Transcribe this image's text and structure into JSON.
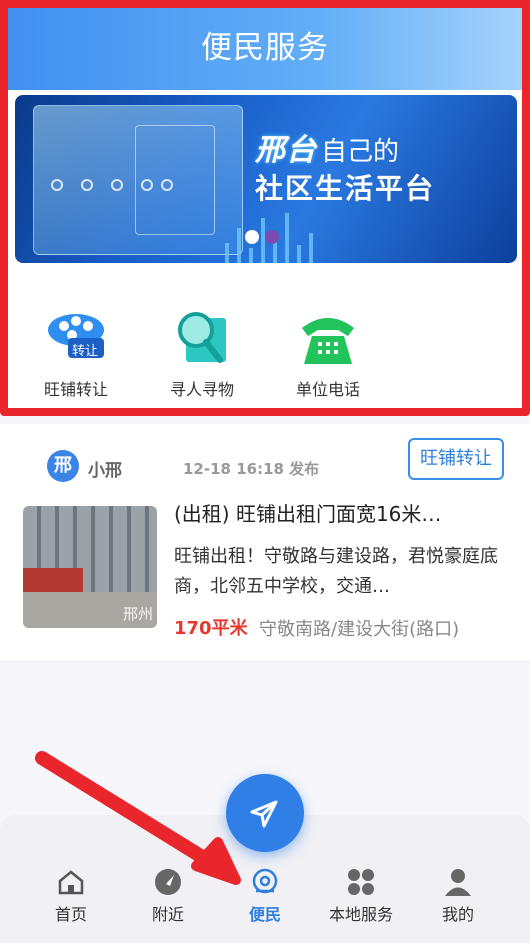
{
  "header": {
    "title": "便民服务"
  },
  "banner": {
    "brand": "邢台",
    "slogan_line1": "自己的",
    "slogan_line2": "社区生活平台",
    "indicator_count": 2,
    "active_indicator": 1
  },
  "entries": [
    {
      "label": "旺铺转让",
      "icon": "shop-transfer-icon",
      "badge": "转让"
    },
    {
      "label": "寻人寻物",
      "icon": "search-magnifier-icon"
    },
    {
      "label": "单位电话",
      "icon": "phone-icon"
    }
  ],
  "post": {
    "avatar_text": "邢",
    "author": "小邢",
    "time": "12-18 16:18 发布",
    "tag": "旺铺转让",
    "title": "(出租) 旺铺出租门面宽16米…",
    "description": "旺铺出租！守敬路与建设路，君悦豪庭底商，北邻五中学校，交通…",
    "area": "170平米",
    "address": "守敬南路/建设大街(路口)",
    "thumb_watermark": "邢州"
  },
  "tabbar": {
    "items": [
      {
        "label": "首页",
        "icon": "home-icon"
      },
      {
        "label": "附近",
        "icon": "compass-icon"
      },
      {
        "label": "便民",
        "icon": "service-icon",
        "active": true
      },
      {
        "label": "本地服务",
        "icon": "grid-icon"
      },
      {
        "label": "我的",
        "icon": "user-icon"
      }
    ]
  },
  "fab": {
    "icon": "send-icon"
  },
  "colors": {
    "accent": "#2f7fdd",
    "highlight": "#e8262c",
    "price": "#e8382e"
  }
}
